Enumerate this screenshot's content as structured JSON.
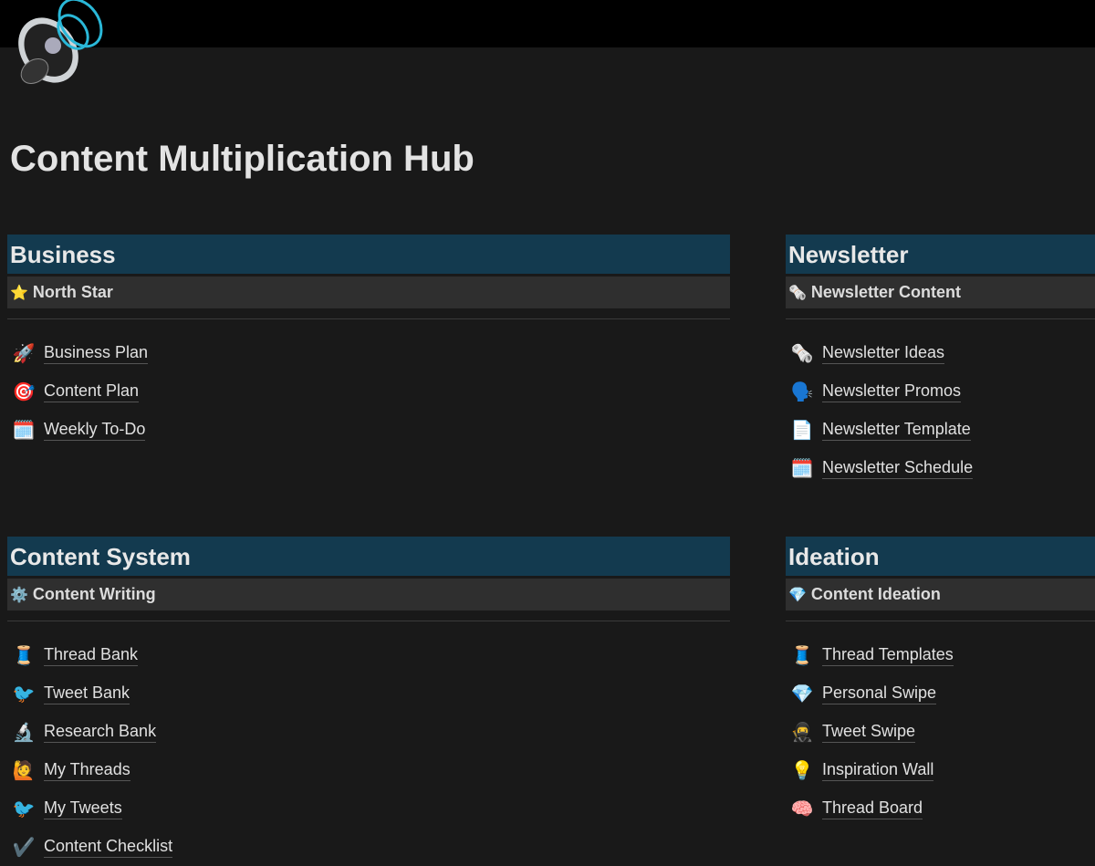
{
  "page": {
    "title": "Content Multiplication Hub",
    "icon": "speaker-icon"
  },
  "sections": [
    {
      "title": "Business",
      "sub": {
        "icon": "⭐",
        "label": "North Star"
      },
      "items": [
        {
          "icon": "🚀",
          "label": "Business Plan"
        },
        {
          "icon": "🎯",
          "label": "Content Plan"
        },
        {
          "icon": "🗓️",
          "label": "Weekly To-Do"
        }
      ]
    },
    {
      "title": "Newsletter",
      "sub": {
        "icon": "🗞️",
        "label": "Newsletter Content"
      },
      "items": [
        {
          "icon": "🗞️",
          "label": "Newsletter Ideas"
        },
        {
          "icon": "🗣️",
          "label": "Newsletter Promos"
        },
        {
          "icon": "📄",
          "label": "Newsletter Template"
        },
        {
          "icon": "🗓️",
          "label": "Newsletter Schedule"
        }
      ]
    },
    {
      "title": "Content System",
      "sub": {
        "icon": "⚙️",
        "label": "Content Writing"
      },
      "items": [
        {
          "icon": "🧵",
          "label": "Thread Bank"
        },
        {
          "icon": "🐦",
          "label": "Tweet Bank"
        },
        {
          "icon": "🔬",
          "label": "Research Bank"
        },
        {
          "icon": "🙋",
          "label": "My Threads"
        },
        {
          "icon": "🐦",
          "label": "My Tweets"
        },
        {
          "icon": "✔️",
          "label": "Content Checklist"
        }
      ]
    },
    {
      "title": "Ideation",
      "sub": {
        "icon": "💎",
        "label": "Content Ideation"
      },
      "items": [
        {
          "icon": "🧵",
          "label": "Thread Templates"
        },
        {
          "icon": "💎",
          "label": "Personal Swipe"
        },
        {
          "icon": "🥷",
          "label": "Tweet Swipe"
        },
        {
          "icon": "💡",
          "label": "Inspiration Wall"
        },
        {
          "icon": "🧠",
          "label": "Thread Board"
        }
      ]
    }
  ]
}
